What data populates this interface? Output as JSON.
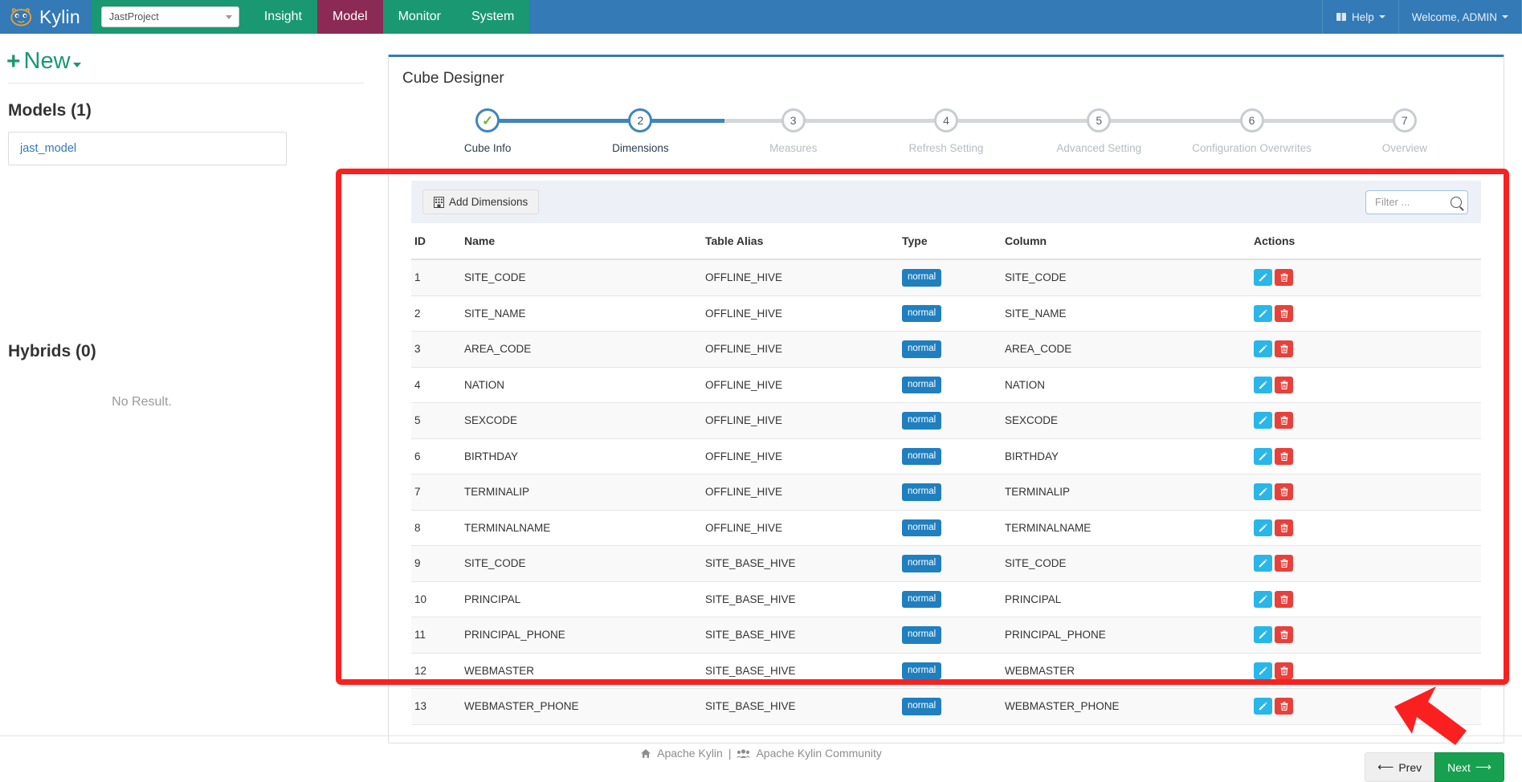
{
  "navbar": {
    "brand": "Kylin",
    "brand_logo_icon": "kylin-lion-logo-icon",
    "project_selector": {
      "value": "JastProject",
      "caret_icon": "chevron-down-icon"
    },
    "links": [
      {
        "label": "Insight",
        "active": false
      },
      {
        "label": "Model",
        "active": true
      },
      {
        "label": "Monitor",
        "active": false
      },
      {
        "label": "System",
        "active": false
      }
    ],
    "right": [
      {
        "label": "Help",
        "icon": "book-icon",
        "caret": true
      },
      {
        "label": "Welcome, ADMIN",
        "icon": "",
        "caret": true
      }
    ]
  },
  "sidebar": {
    "new_button": {
      "label": "New",
      "plus": "+",
      "icon": "plus-icon"
    },
    "models_heading": "Models (1)",
    "models": [
      {
        "name": "jast_model"
      }
    ],
    "hybrids_heading": "Hybrids (0)",
    "hybrids_empty": "No Result."
  },
  "main": {
    "panel_title": "Cube Designer",
    "steps": [
      {
        "num": "1",
        "label": "Cube Info",
        "state": "done"
      },
      {
        "num": "2",
        "label": "Dimensions",
        "state": "current"
      },
      {
        "num": "3",
        "label": "Measures",
        "state": "todo"
      },
      {
        "num": "4",
        "label": "Refresh Setting",
        "state": "todo"
      },
      {
        "num": "5",
        "label": "Advanced Setting",
        "state": "todo"
      },
      {
        "num": "6",
        "label": "Configuration Overwrites",
        "state": "todo"
      },
      {
        "num": "7",
        "label": "Overview",
        "state": "todo"
      }
    ],
    "toolbar": {
      "add_dimensions_label": "Add Dimensions",
      "add_dimensions_icon": "table-icon",
      "filter_placeholder": "Filter ...",
      "filter_value": "",
      "search_icon": "search-icon"
    },
    "table": {
      "columns": [
        "ID",
        "Name",
        "Table Alias",
        "Type",
        "Column",
        "Actions"
      ],
      "rows": [
        {
          "id": "1",
          "name": "SITE_CODE",
          "alias": "OFFLINE_HIVE",
          "type": "normal",
          "column": "SITE_CODE"
        },
        {
          "id": "2",
          "name": "SITE_NAME",
          "alias": "OFFLINE_HIVE",
          "type": "normal",
          "column": "SITE_NAME"
        },
        {
          "id": "3",
          "name": "AREA_CODE",
          "alias": "OFFLINE_HIVE",
          "type": "normal",
          "column": "AREA_CODE"
        },
        {
          "id": "4",
          "name": "NATION",
          "alias": "OFFLINE_HIVE",
          "type": "normal",
          "column": "NATION"
        },
        {
          "id": "5",
          "name": "SEXCODE",
          "alias": "OFFLINE_HIVE",
          "type": "normal",
          "column": "SEXCODE"
        },
        {
          "id": "6",
          "name": "BIRTHDAY",
          "alias": "OFFLINE_HIVE",
          "type": "normal",
          "column": "BIRTHDAY"
        },
        {
          "id": "7",
          "name": "TERMINALIP",
          "alias": "OFFLINE_HIVE",
          "type": "normal",
          "column": "TERMINALIP"
        },
        {
          "id": "8",
          "name": "TERMINALNAME",
          "alias": "OFFLINE_HIVE",
          "type": "normal",
          "column": "TERMINALNAME"
        },
        {
          "id": "9",
          "name": "SITE_CODE",
          "alias": "SITE_BASE_HIVE",
          "type": "normal",
          "column": "SITE_CODE"
        },
        {
          "id": "10",
          "name": "PRINCIPAL",
          "alias": "SITE_BASE_HIVE",
          "type": "normal",
          "column": "PRINCIPAL"
        },
        {
          "id": "11",
          "name": "PRINCIPAL_PHONE",
          "alias": "SITE_BASE_HIVE",
          "type": "normal",
          "column": "PRINCIPAL_PHONE"
        },
        {
          "id": "12",
          "name": "WEBMASTER",
          "alias": "SITE_BASE_HIVE",
          "type": "normal",
          "column": "WEBMASTER"
        },
        {
          "id": "13",
          "name": "WEBMASTER_PHONE",
          "alias": "SITE_BASE_HIVE",
          "type": "normal",
          "column": "WEBMASTER_PHONE"
        }
      ],
      "row_actions": {
        "edit_icon": "pencil-icon",
        "delete_icon": "trash-icon"
      }
    },
    "buttons": {
      "prev_label": "Prev",
      "next_label": "Next",
      "prev_icon": "arrow-left-icon",
      "next_icon": "arrow-right-icon"
    }
  },
  "footer": {
    "home_icon": "home-icon",
    "link1": "Apache Kylin",
    "separator": "|",
    "group_icon": "users-icon",
    "link2": "Apache Kylin Community"
  },
  "annotations": {
    "highlight_box_color": "#fb2020",
    "arrow_color": "#fb2020",
    "arrow_target": "next-button"
  },
  "colors": {
    "navbar_blue": "#337ab7",
    "nav_green": "#1a9872",
    "nav_active_maroon": "#8a2a55",
    "badge_blue": "#1f7fbf",
    "edit_blue": "#29b6e8",
    "delete_red": "#e8403a",
    "next_green": "#17a04f",
    "step_active_blue": "#3e86b9",
    "check_green": "#6cb832"
  }
}
